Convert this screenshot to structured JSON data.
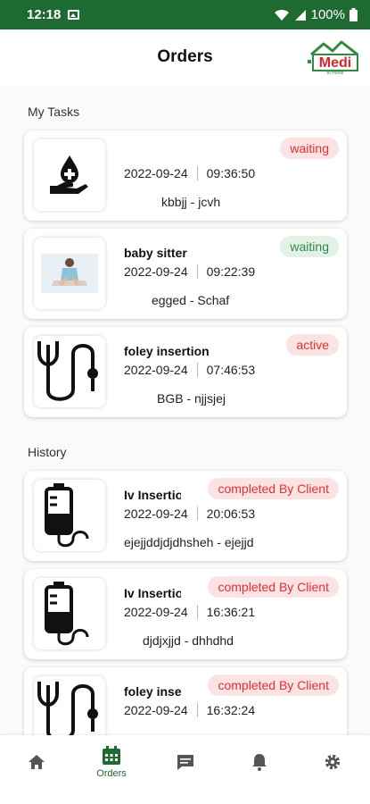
{
  "status_bar": {
    "time": "12:18",
    "battery": "100%"
  },
  "header": {
    "title": "Orders",
    "logo_text": "Medi",
    "logo_sub": "to Home"
  },
  "sections": {
    "tasks_label": "My Tasks",
    "history_label": "History"
  },
  "tasks": [
    {
      "title": "",
      "date": "2022-09-24",
      "time": "09:36:50",
      "names": "kbbjj - jcvh",
      "status": "waiting",
      "status_color": "red",
      "icon": "hand-blood-drop-icon"
    },
    {
      "title": "baby sitter",
      "date": "2022-09-24",
      "time": "09:22:39",
      "names": "egged - Schaf",
      "status": "waiting",
      "status_color": "green",
      "icon": "baby-sitter-photo"
    },
    {
      "title": "foley insertion",
      "date": "2022-09-24",
      "time": "07:46:53",
      "names": "BGB - njjsjej",
      "status": "active",
      "status_color": "red",
      "icon": "catheter-icon"
    }
  ],
  "history": [
    {
      "title": "Iv Insertion",
      "date": "2022-09-24",
      "time": "20:06:53",
      "names": "ejejjddjdjdhsheh - ejejjd",
      "status": "completed By Client",
      "status_color": "red",
      "icon": "iv-bag-icon"
    },
    {
      "title": "Iv Insertion",
      "date": "2022-09-24",
      "time": "16:36:21",
      "names": "djdjxjjd - dhhdhd",
      "status": "completed By Client",
      "status_color": "red",
      "icon": "iv-bag-icon"
    },
    {
      "title": "foley insertion",
      "date": "2022-09-24",
      "time": "16:32:24",
      "names": "",
      "status": "completed By Client",
      "status_color": "red",
      "icon": "catheter-icon"
    }
  ],
  "nav": {
    "orders_label": "Orders"
  },
  "colors": {
    "brand": "#1e6b32",
    "badge_red": "#e03131",
    "badge_green": "#2f8a44"
  }
}
